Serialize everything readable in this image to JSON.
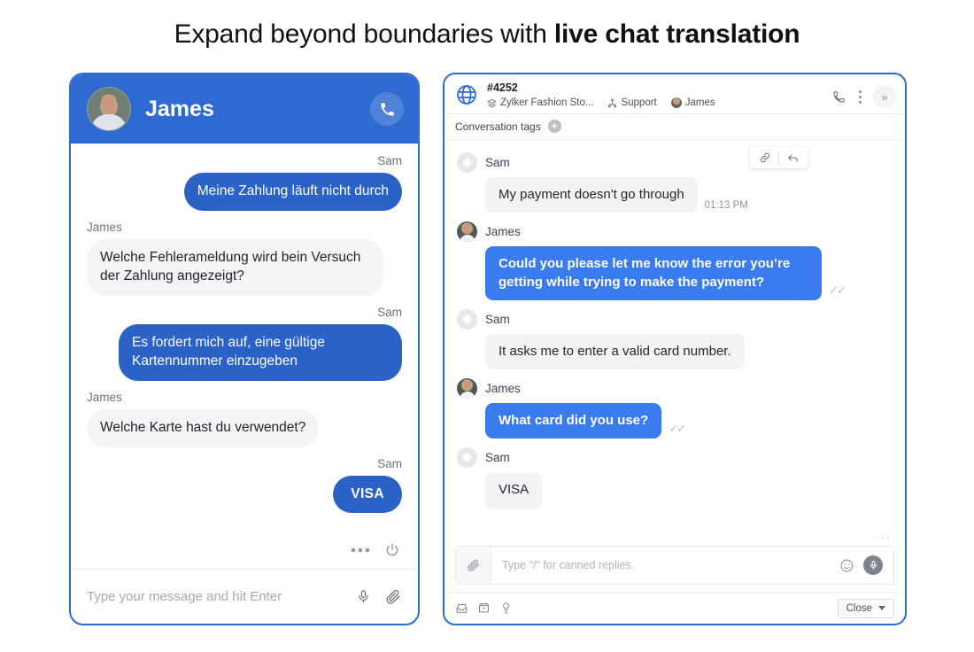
{
  "headline": {
    "light": "Expand beyond boundaries with ",
    "bold": "live chat translation"
  },
  "widget": {
    "title": "James",
    "avatar_name": "james-avatar",
    "call_icon": "phone-icon",
    "messages": [
      {
        "sender": "Sam",
        "side": "out",
        "text": "Meine Zahlung läuft nicht durch"
      },
      {
        "sender": "James",
        "side": "in",
        "text": "Welche Fehlerameldung wird bein Versuch der Zahlung angezeigt?"
      },
      {
        "sender": "Sam",
        "side": "out",
        "text": "Es fordert mich auf, eine gültige Kartennummer einzugeben"
      },
      {
        "sender": "James",
        "side": "in",
        "text": "Welche Karte hast du verwendet?"
      },
      {
        "sender": "Sam",
        "side": "out",
        "text": "VISA"
      }
    ],
    "actions": {
      "more": "more-icon",
      "power": "power-icon"
    },
    "composer": {
      "placeholder": "Type your message and hit Enter",
      "mic": "mic-icon",
      "attach": "paperclip-icon"
    }
  },
  "desk": {
    "ticket_id": "#4252",
    "breadcrumbs": [
      {
        "icon": "layers-icon",
        "label": "Zylker Fashion Sto..."
      },
      {
        "icon": "org-tree-icon",
        "label": "Support"
      },
      {
        "icon": "agent-avatar",
        "label": "James"
      }
    ],
    "header_icons": [
      "share-screen-icon",
      "phone-icon",
      "more-vertical-icon"
    ],
    "expand_label": "»",
    "tags": {
      "label": "Conversation tags",
      "add": "+"
    },
    "hover_tools": [
      "link-icon",
      "reply-icon"
    ],
    "messages": [
      {
        "sender": "Sam",
        "avatar": "sam",
        "side": "in",
        "text": "My payment doesn't go through",
        "time": "01:13 PM",
        "tools": true
      },
      {
        "sender": "James",
        "avatar": "james",
        "side": "out",
        "text": "Could you please let me know the error you’re getting while trying to make the payment?",
        "ticks": "✓✓"
      },
      {
        "sender": "Sam",
        "avatar": "sam",
        "side": "in",
        "text": "It asks me to enter a valid card number."
      },
      {
        "sender": "James",
        "avatar": "james",
        "side": "out",
        "text": "What card did you use?",
        "ticks": "✓✓"
      },
      {
        "sender": "Sam",
        "avatar": "sam",
        "side": "in",
        "text": "VISA"
      }
    ],
    "typing_dots": "···",
    "composer": {
      "placeholder": "Type \"/\" for canned replies.",
      "attach": "paperclip-icon",
      "emoji": "emoji-icon",
      "mic": "mic-icon"
    },
    "footer_icons": [
      "inbox-icon",
      "archive-icon",
      "tag-icon"
    ],
    "close_button": "Close"
  },
  "colors": {
    "widget_blue": "#2f6ad0",
    "widget_bubble_blue": "#2b62c8",
    "desk_bubble_blue": "#3a7bf0",
    "bubble_gray": "#f2f3f5"
  }
}
